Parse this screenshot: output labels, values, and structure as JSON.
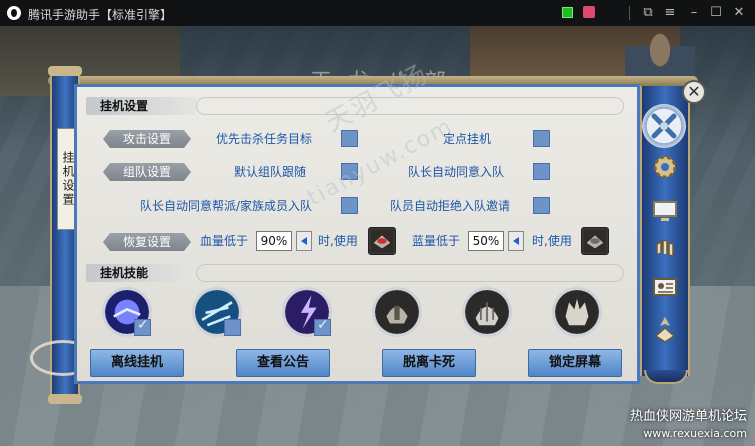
{
  "titlebar": {
    "app_title": "腾讯手游助手【标准引擎】",
    "icons": [
      "tencent-logo-icon",
      "green-status-icon",
      "gift-icon",
      "fullscreen-icon",
      "menu-icon",
      "minimize-icon",
      "maximize-icon",
      "close-icon"
    ]
  },
  "scene": {
    "banner": "天龙八部"
  },
  "side_tab": {
    "label": "挂机设置"
  },
  "section_settings": {
    "title": "挂机设置"
  },
  "rows": {
    "attack": {
      "label": "攻击设置",
      "opt1": "优先击杀任务目标",
      "opt2": "定点挂机"
    },
    "team": {
      "label": "组队设置",
      "opt1": "默认组队跟随",
      "opt2": "队长自动同意入队",
      "opt3": "队长自动同意帮派/家族成员入队",
      "opt4": "队员自动拒绝入队邀请"
    },
    "recover": {
      "label": "恢复设置",
      "hp_label": "血量低于",
      "hp_value": "90%",
      "hp_use": "时,使用",
      "mp_label": "蓝量低于",
      "mp_value": "50%",
      "mp_use": "时,使用"
    }
  },
  "section_skills": {
    "title": "挂机技能",
    "skills": [
      {
        "icon": "lightning-orb-skill-icon",
        "checked": true
      },
      {
        "icon": "ice-shard-skill-icon",
        "checked": false
      },
      {
        "icon": "thunder-strike-skill-icon",
        "checked": true
      },
      {
        "icon": "guardian-helm-skill-icon",
        "checked": false
      },
      {
        "icon": "silver-helm-skill-icon",
        "checked": false
      },
      {
        "icon": "crown-helm-skill-icon",
        "checked": false
      }
    ]
  },
  "buttons": {
    "offline": "离线挂机",
    "notice": "查看公告",
    "unstuck": "脱离卡死",
    "lock": "锁定屏幕"
  },
  "right_nav": [
    "crossed-swords-icon",
    "gear-icon",
    "monitor-icon",
    "gloves-icon",
    "id-card-icon",
    "rank-badge-icon"
  ],
  "watermarks": {
    "site": "tianyuw.com",
    "forum_name": "热血侠网游单机论坛",
    "forum_url": "www.rexuexia.com",
    "diag": "天羽飞扬"
  },
  "colors": {
    "accent_blue": "#4a78b8",
    "option_text": "#1c56a8",
    "button_blue": "#4f86c7",
    "checkbox": "#6e93c8"
  }
}
